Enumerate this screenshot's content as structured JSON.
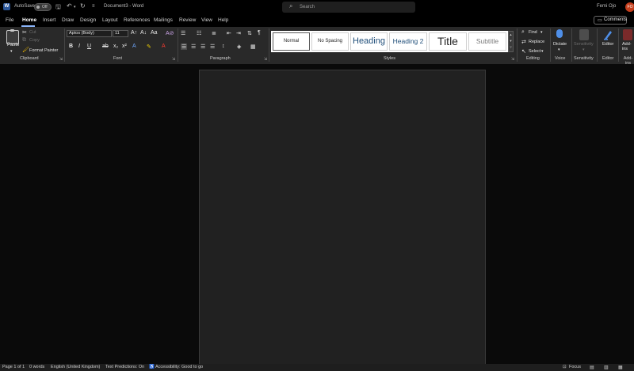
{
  "titlebar": {
    "autosave_label": "AutoSave",
    "autosave_state": "Off",
    "doc_title": "Document3 - Word",
    "search_placeholder": "Search",
    "user_name": "Femi Ojo",
    "user_initials": "FO"
  },
  "tabs": [
    "File",
    "Home",
    "Insert",
    "Draw",
    "Design",
    "Layout",
    "References",
    "Mailings",
    "Review",
    "View",
    "Help"
  ],
  "active_tab": "Home",
  "comments_label": "Comments",
  "ribbon": {
    "clipboard": {
      "paste": "Paste",
      "cut": "Cut",
      "copy": "Copy",
      "format_painter": "Format Painter",
      "label": "Clipboard"
    },
    "font": {
      "font_name": "Aptos (Body)",
      "font_size": "11",
      "label": "Font"
    },
    "paragraph": {
      "label": "Paragraph"
    },
    "styles": {
      "label": "Styles",
      "items": [
        "Normal",
        "No Spacing",
        "Heading",
        "Heading 2",
        "Title",
        "Subtitle"
      ]
    },
    "editing": {
      "find": "Find",
      "replace": "Replace",
      "select": "Select",
      "label": "Editing"
    },
    "voice": {
      "dictate": "Dictate",
      "label": "Voice"
    },
    "sensitivity": {
      "button": "Sensitivity",
      "label": "Sensitivity"
    },
    "editor": {
      "button": "Editor",
      "label": "Editor"
    },
    "addins": {
      "label": "Add-ins"
    }
  },
  "status": {
    "page": "Page 1 of 1",
    "words": "0 words",
    "language": "English (United Kingdom)",
    "predictions": "Text Predictions: On",
    "accessibility": "Accessibility: Good to go",
    "focus": "Focus"
  },
  "colors": {
    "accent": "#2b579a",
    "bg": "#0a0a0a",
    "ribbon": "#292929",
    "page": "#212121"
  }
}
